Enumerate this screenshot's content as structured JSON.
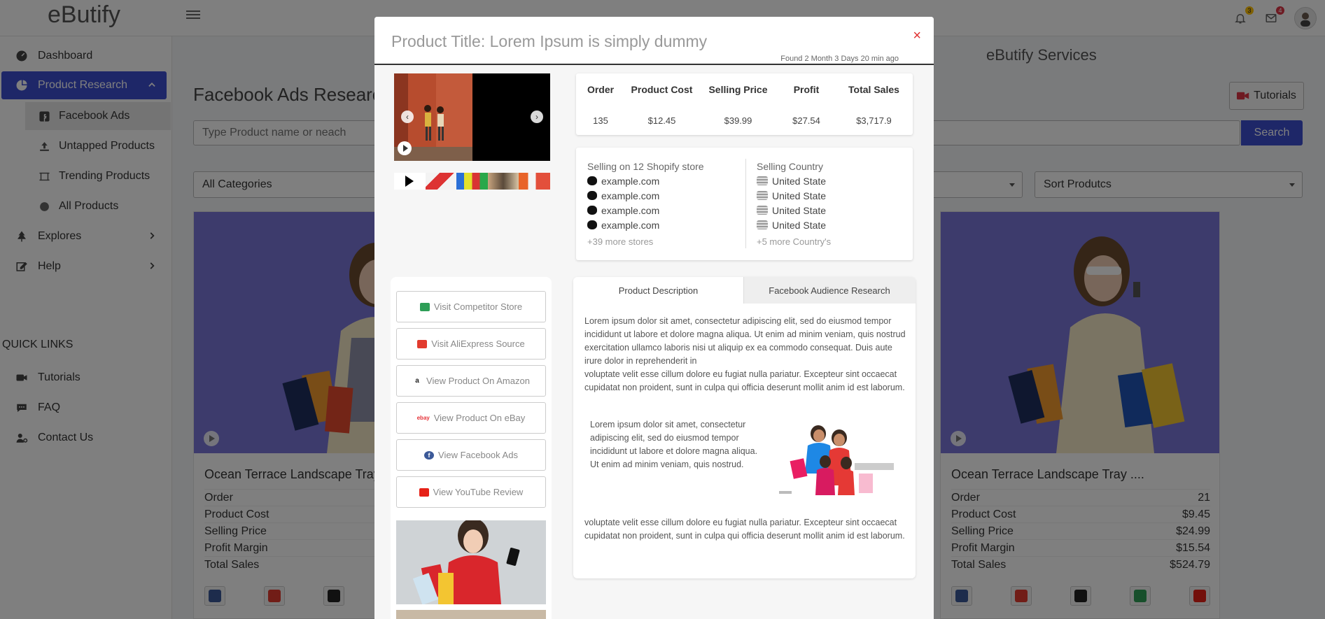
{
  "app": {
    "brand": "eButify"
  },
  "topbar": {
    "notifications_count": "3",
    "messages_count": "4"
  },
  "sidebar": {
    "items": [
      {
        "label": "Dashboard",
        "icon": "dashboard-icon"
      },
      {
        "label": "Product Research",
        "icon": "pie-chart-icon"
      },
      {
        "label": "Explores",
        "icon": "tree-icon"
      },
      {
        "label": "Help",
        "icon": "edit-icon"
      }
    ],
    "subitems": [
      {
        "label": "Facebook Ads",
        "icon": "facebook-icon"
      },
      {
        "label": "Untapped Products",
        "icon": "upload-icon"
      },
      {
        "label": "Trending Products",
        "icon": "crop-icon"
      },
      {
        "label": "All Products",
        "icon": "circle-icon"
      }
    ],
    "quick_links_title": "QUICK LINKS",
    "quick_links": [
      {
        "label": "Tutorials",
        "icon": "video-icon"
      },
      {
        "label": "FAQ",
        "icon": "chat-icon"
      },
      {
        "label": "Contact Us",
        "icon": "user-cog-icon"
      }
    ]
  },
  "main": {
    "services_title": "eButify Services",
    "page_title": "Facebook Ads Research",
    "tutorials_label": "Tutorials",
    "search_placeholder": "Type Product name or neach",
    "search_label": "Search",
    "category_select": "All Categories",
    "sort_select": "Sort Produtcs",
    "cards": [
      {
        "title": "Ocean Terrace Landscape Tray ...",
        "rows": [
          {
            "label": "Order",
            "value": ""
          },
          {
            "label": "Product Cost",
            "value": ""
          },
          {
            "label": "Selling Price",
            "value": ""
          },
          {
            "label": "Profit Margin",
            "value": ""
          },
          {
            "label": "Total Sales",
            "value": ""
          }
        ]
      },
      {
        "title": "Ocean Terrace Landscape Tray ....",
        "rows": [
          {
            "label": "Order",
            "value": "21"
          },
          {
            "label": "Product Cost",
            "value": "$9.45"
          },
          {
            "label": "Selling Price",
            "value": "$24.99"
          },
          {
            "label": "Profit Margin",
            "value": "$15.54"
          },
          {
            "label": "Total Sales",
            "value": "$524.79"
          }
        ]
      }
    ]
  },
  "modal": {
    "title": "Product Title: Lorem Ipsum is simply dummy",
    "close_symbol": "×",
    "found": "Found 2 Month 3 Days 20 min ago",
    "stats": {
      "headers": [
        "Order",
        "Product Cost",
        "Selling Price",
        "Profit",
        "Total Sales"
      ],
      "values": [
        "135",
        "$12.45",
        "$39.99",
        "$27.54",
        "$3,717.9"
      ]
    },
    "stores": {
      "heading": "Selling on 12 Shopify store",
      "list": [
        "example.com",
        "example.com",
        "example.com",
        "example.com"
      ],
      "more": "+39 more stores"
    },
    "countries": {
      "heading": "Selling Country",
      "list": [
        "United State",
        "United State",
        "United State",
        "United State"
      ],
      "more": "+5 more Country's"
    },
    "links": [
      {
        "label": "Visit Competitor Store",
        "icon": "store-icon",
        "color": "#2e9e57"
      },
      {
        "label": "Visit AliExpress Source",
        "icon": "aliexpress-icon",
        "color": "#e23b2e"
      },
      {
        "label": "View Product On Amazon",
        "icon": "amazon-icon",
        "color": "#222222"
      },
      {
        "label": "View Product On eBay",
        "icon": "ebay-icon",
        "color": "#e53238"
      },
      {
        "label": "View Facebook Ads",
        "icon": "facebook-icon",
        "color": "#3b5998"
      },
      {
        "label": "View YouTube Review",
        "icon": "youtube-icon",
        "color": "#e62117"
      }
    ],
    "tabs": [
      "Product Description",
      "Facebook Audience Research"
    ],
    "description": {
      "para1": "Lorem ipsum dolor sit amet, consectetur adipiscing elit, sed do eiusmod tempor incididunt ut labore et dolore magna aliqua. Ut enim ad minim veniam, quis nostrud exercitation ullamco laboris nisi ut aliquip ex ea commodo consequat. Duis aute irure dolor in reprehenderit in",
      "para2": "voluptate velit esse cillum dolore eu fugiat nulla pariatur. Excepteur sint occaecat cupidatat non proident, sunt in culpa qui officia deserunt mollit anim id est laborum.",
      "inner": "Lorem ipsum dolor sit amet, consectetur adipiscing elit, sed do eiusmod tempor incididunt ut labore et dolore magna aliqua. Ut enim ad minim veniam, quis nostrud.",
      "para3": "voluptate velit esse cillum dolore eu fugiat nulla pariatur. Excepteur sint occaecat cupidatat non proident, sunt in culpa qui officia deserunt mollit anim id est laborum."
    }
  },
  "colors": {
    "accent": "#3d4ed0",
    "close": "#e03131",
    "card_bg": "#7a76d8"
  }
}
